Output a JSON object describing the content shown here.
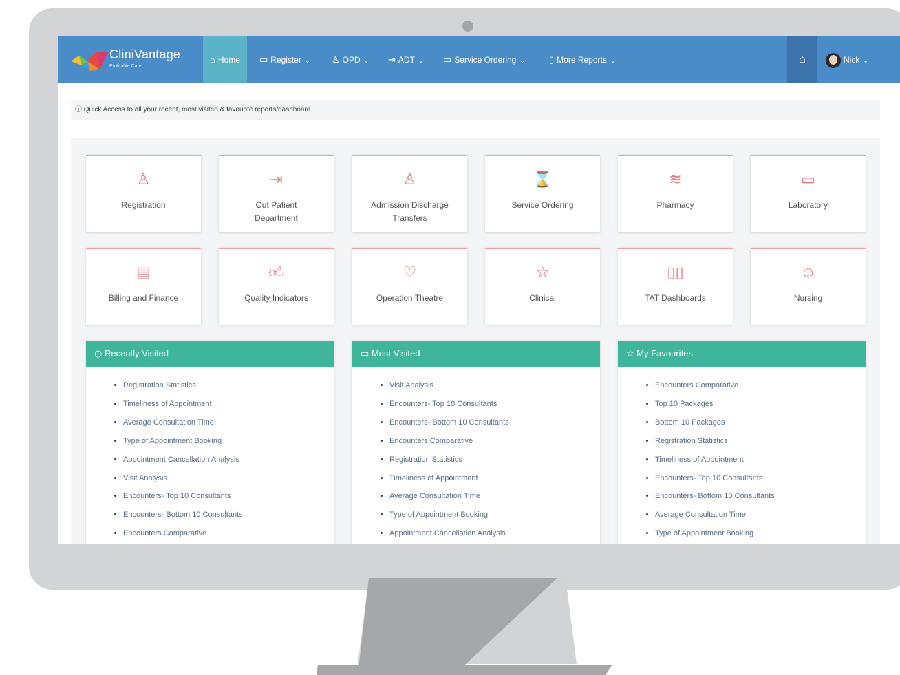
{
  "app": {
    "logo_text": "CliniVantage",
    "logo_sub": "Profitable Care..."
  },
  "nav": {
    "items": [
      {
        "label": "Home",
        "icon": "home-icon"
      },
      {
        "label": "Register",
        "icon": "monitor-icon"
      },
      {
        "label": "OPD",
        "icon": "user-icon"
      },
      {
        "label": "ADT",
        "icon": "login-icon"
      },
      {
        "label": "Service Ordering",
        "icon": "monitor-icon"
      },
      {
        "label": "More Reports",
        "icon": "document-icon"
      }
    ],
    "user": "Nick"
  },
  "info_text": "ⓘ Quick Access to all your recent, most visited & favourite reports/dashboard",
  "tiles": [
    {
      "label": "Registration",
      "icon": "user-icon"
    },
    {
      "label": "Out Patient Department",
      "icon": "login-icon"
    },
    {
      "label": "Admission Discharge Transfers",
      "icon": "user-icon"
    },
    {
      "label": "Service Ordering",
      "icon": "hourglass-icon"
    },
    {
      "label": "Pharmacy",
      "icon": "layers-icon"
    },
    {
      "label": "Laboratory",
      "icon": "monitor-icon"
    },
    {
      "label": "Billing and Finance",
      "icon": "wallet-icon"
    },
    {
      "label": "Quality Indicators",
      "icon": "thumbs-up-icon"
    },
    {
      "label": "Operation Theatre",
      "icon": "heart-icon"
    },
    {
      "label": "Clinical",
      "icon": "star-icon"
    },
    {
      "label": "TAT Dashboards",
      "icon": "bar-chart-icon"
    },
    {
      "label": "Nursing",
      "icon": "smiley-icon"
    }
  ],
  "panels": {
    "recent": {
      "title": "Recently Visited",
      "items": [
        "Registration Statistics",
        "Timeliness of Appointment",
        "Average Consultation Time",
        "Type of Appointment Booking",
        "Appointment Cancellation Analysis",
        "Visit Analysis",
        "Encounters- Top 10 Consultants",
        "Encounters- Bottom 10 Consultants",
        "Encounters Comparative"
      ]
    },
    "most": {
      "title": "Most Visited",
      "items": [
        "Visit Analysis",
        "Encounters- Top 10 Consultants",
        "Encounters- Bottom 10 Consultants",
        "Encounters Comparative",
        "Registration Statistics",
        "Timeliness of Appointment",
        "Average Consultation Time",
        "Type of Appointment Booking",
        "Appointment Cancellation Analysis"
      ]
    },
    "fav": {
      "title": "My Favourites",
      "items": [
        "Encounters Comparative",
        "Top 10 Packages",
        "Bottom 10 Packages",
        "Registration Statistics",
        "Timeliness of Appointment",
        "Encounters- Top 10 Consultants",
        "Encounters- Bottom 10 Consultants",
        "Average Consultation Time",
        "Type of Appointment Booking"
      ]
    }
  },
  "colors": {
    "navbar": "#4a8cc7",
    "nav_active": "#5bb3c8",
    "panel_header": "#3fb59c",
    "tile_accent": "#f1a0a6",
    "tile_icon": "#e8737a"
  }
}
